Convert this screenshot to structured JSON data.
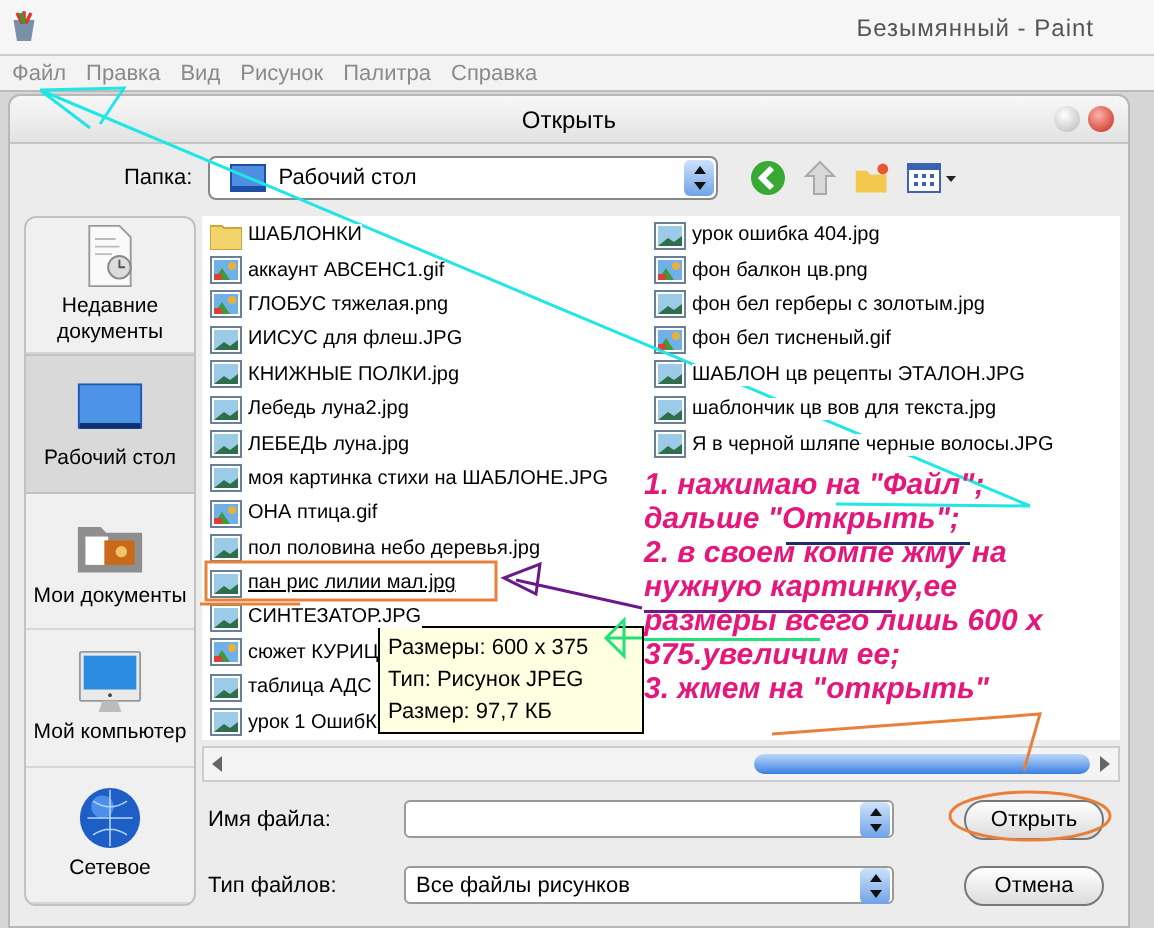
{
  "app": {
    "title": "Безымянный - Paint",
    "menu": [
      "Файл",
      "Правка",
      "Вид",
      "Рисунок",
      "Палитра",
      "Справка"
    ]
  },
  "dialog": {
    "title": "Открыть",
    "folder_label": "Папка:",
    "folder": "Рабочий стол"
  },
  "places": [
    {
      "label": "Недавние документы",
      "selected": false
    },
    {
      "label": "Рабочий стол",
      "selected": true
    },
    {
      "label": "Мои документы",
      "selected": false
    },
    {
      "label": "Мой компьютер",
      "selected": false
    },
    {
      "label": "Сетевое",
      "selected": false
    }
  ],
  "files": [
    [
      {
        "name": "ШАБЛОНКИ",
        "kind": "folder",
        "hovered": false
      },
      {
        "name": "аккаунт АВСЕНС1.gif",
        "kind": "gif",
        "hovered": false
      },
      {
        "name": "ГЛОБУС тяжелая.png",
        "kind": "gif",
        "hovered": false
      },
      {
        "name": "ИИСУС для флеш.JPG",
        "kind": "photo",
        "hovered": false
      },
      {
        "name": "КНИЖНЫЕ ПОЛКИ.jpg",
        "kind": "photo",
        "hovered": false
      },
      {
        "name": "Лебедь луна2.jpg",
        "kind": "photo",
        "hovered": false
      },
      {
        "name": "ЛЕБЕДЬ луна.jpg",
        "kind": "photo",
        "hovered": false
      },
      {
        "name": "моя картинка стихи на ШАБЛОНЕ.JPG",
        "kind": "photo",
        "hovered": false
      },
      {
        "name": "ОНА птица.gif",
        "kind": "gif",
        "hovered": false
      },
      {
        "name": "пол половина небо деревья.jpg",
        "kind": "photo",
        "hovered": false
      },
      {
        "name": "пан рис лилии мал.jpg",
        "kind": "photo",
        "hovered": true
      },
      {
        "name": "СИНТЕЗАТОР.JPG",
        "kind": "photo",
        "hovered": false
      },
      {
        "name": "сюжет КУРИЦ",
        "kind": "gif",
        "hovered": false
      },
      {
        "name": "таблица АДС",
        "kind": "photo",
        "hovered": false
      },
      {
        "name": "урок 1 ОшибК",
        "kind": "photo",
        "hovered": false
      }
    ],
    [
      {
        "name": "урок ошибка 404.jpg",
        "kind": "photo",
        "hovered": false
      },
      {
        "name": "фон балкон цв.png",
        "kind": "gif",
        "hovered": false
      },
      {
        "name": "фон бел герберы с золотым.jpg",
        "kind": "photo",
        "hovered": false
      },
      {
        "name": "фон бел тисненый.gif",
        "kind": "gif",
        "hovered": false
      },
      {
        "name": "ШАБЛОН цв рецепты ЭТАЛОН.JPG",
        "kind": "photo",
        "hovered": false
      },
      {
        "name": "шаблончик цв вов для текста.jpg",
        "kind": "photo",
        "hovered": false
      },
      {
        "name": "Я в черной шляпе черные волосы.JPG",
        "kind": "photo",
        "hovered": false
      }
    ]
  ],
  "tooltip": [
    "Размеры: 600 x 375",
    "Тип: Рисунок JPEG",
    "Размер: 97,7 КБ"
  ],
  "file_name": {
    "label": "Имя файла:"
  },
  "file_type": {
    "label": "Тип файлов:",
    "value": "Все файлы рисунков"
  },
  "buttons": [
    "Открыть",
    "Отмена"
  ],
  "annotation": "1. нажимаю на \"Файл\";\nдальше \"Открыть\";\n2. в своем компе жму на\nнужную картинку,ее\nразмеры всего лишь 600 х\n375.увеличим ее;\n3. жмем на \"открыть\""
}
